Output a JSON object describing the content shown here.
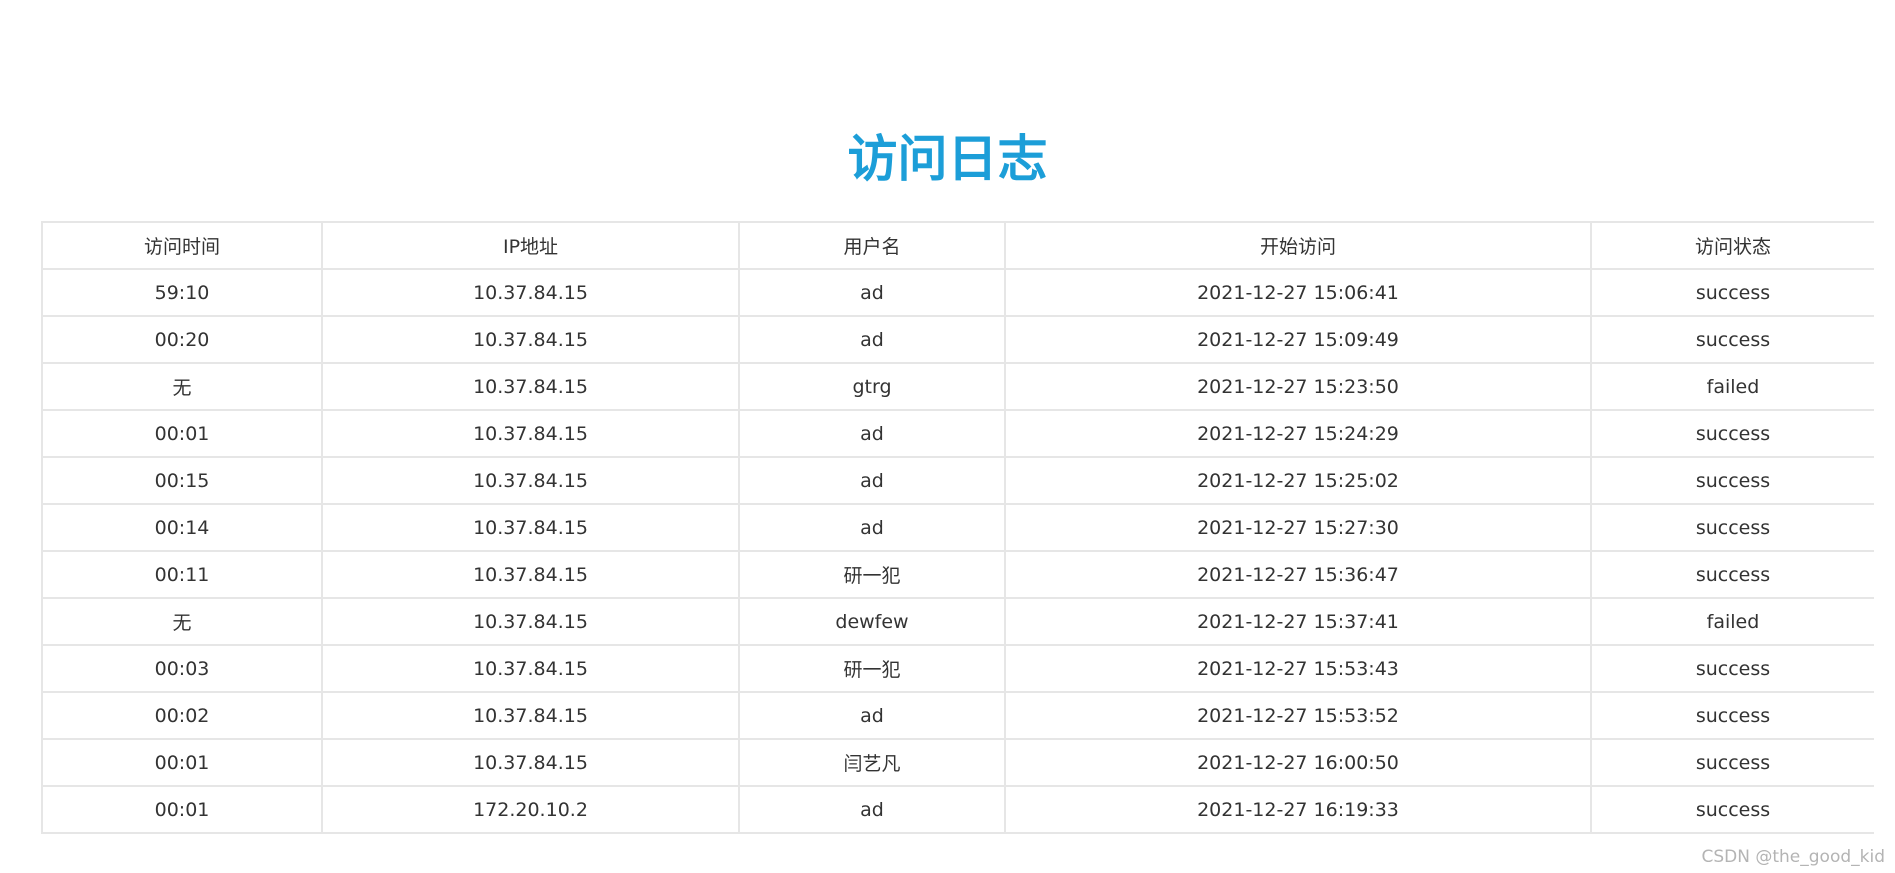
{
  "page": {
    "title": "访问日志",
    "accent_color": "#1c9ed8",
    "border_color": "#e6e6e6"
  },
  "table": {
    "columns": [
      "访问时间",
      "IP地址",
      "用户名",
      "开始访问",
      "访问状态"
    ],
    "rows": [
      [
        "59:10",
        "10.37.84.15",
        "ad",
        "2021-12-27 15:06:41",
        "success"
      ],
      [
        "00:20",
        "10.37.84.15",
        "ad",
        "2021-12-27 15:09:49",
        "success"
      ],
      [
        "无",
        "10.37.84.15",
        "gtrg",
        "2021-12-27 15:23:50",
        "failed"
      ],
      [
        "00:01",
        "10.37.84.15",
        "ad",
        "2021-12-27 15:24:29",
        "success"
      ],
      [
        "00:15",
        "10.37.84.15",
        "ad",
        "2021-12-27 15:25:02",
        "success"
      ],
      [
        "00:14",
        "10.37.84.15",
        "ad",
        "2021-12-27 15:27:30",
        "success"
      ],
      [
        "00:11",
        "10.37.84.15",
        "研一犯",
        "2021-12-27 15:36:47",
        "success"
      ],
      [
        "无",
        "10.37.84.15",
        "dewfew",
        "2021-12-27 15:37:41",
        "failed"
      ],
      [
        "00:03",
        "10.37.84.15",
        "研一犯",
        "2021-12-27 15:53:43",
        "success"
      ],
      [
        "00:02",
        "10.37.84.15",
        "ad",
        "2021-12-27 15:53:52",
        "success"
      ],
      [
        "00:01",
        "10.37.84.15",
        "闫艺凡",
        "2021-12-27 16:00:50",
        "success"
      ],
      [
        "00:01",
        "172.20.10.2",
        "ad",
        "2021-12-27 16:19:33",
        "success"
      ]
    ]
  },
  "watermark": "CSDN @the_good_kid"
}
